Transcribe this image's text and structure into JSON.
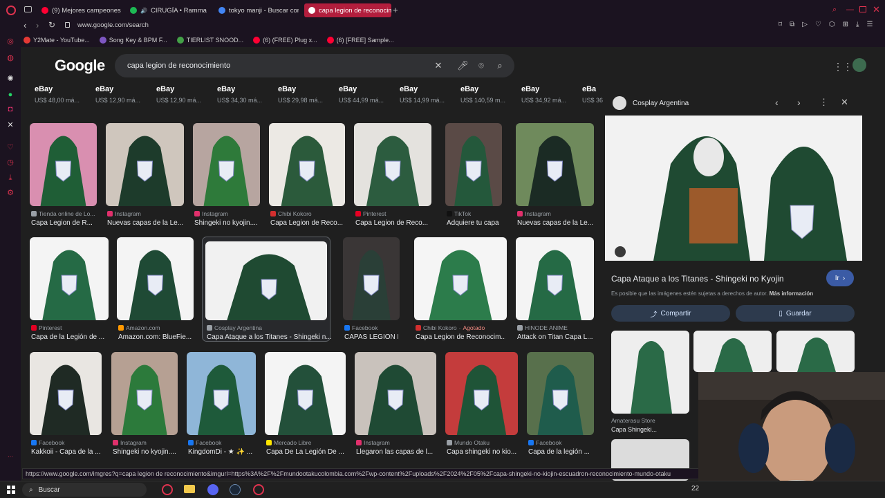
{
  "tabs": [
    {
      "label": "(9) Mejores campeones de",
      "icon": "youtube-icon",
      "color": "#ff0033"
    },
    {
      "label": "CIRUGÍA • Ramma",
      "icon": "spotify-icon",
      "color": "#1db954"
    },
    {
      "label": "tokyo manji - Buscar con",
      "icon": "google-icon",
      "color": "#4285f4"
    },
    {
      "label": "capa legion de reconocimi",
      "icon": "google-icon",
      "color": "#4285f4"
    }
  ],
  "address": "www.google.com/search",
  "bookmarks": [
    {
      "label": "Y2Mate - YouTube...",
      "color": "#e53935"
    },
    {
      "label": "Song Key & BPM F...",
      "color": "#7e57c2"
    },
    {
      "label": "TIERLIST SNOOD...",
      "color": "#43a047"
    },
    {
      "label": "(6) (FREE) Plug x...",
      "color": "#ff0033"
    },
    {
      "label": "(6) [FREE] Sample...",
      "color": "#ff0033"
    }
  ],
  "google": {
    "logo": "Google",
    "query": "capa legion de reconocimiento"
  },
  "shopping": [
    {
      "store": "eBay",
      "price": "US$ 48,00 má..."
    },
    {
      "store": "eBay",
      "price": "US$ 12,90 má..."
    },
    {
      "store": "eBay",
      "price": "US$ 12,90 má..."
    },
    {
      "store": "eBay",
      "price": "US$ 34,30 má..."
    },
    {
      "store": "eBay",
      "price": "US$ 29,98 má..."
    },
    {
      "store": "eBay",
      "price": "US$ 44,99 má..."
    },
    {
      "store": "eBay",
      "price": "US$ 14,99 má..."
    },
    {
      "store": "eBay",
      "price": "US$ 140,59 m..."
    },
    {
      "store": "eBay",
      "price": "US$ 34,92 má..."
    },
    {
      "store": "eBa",
      "price": "US$ 36"
    }
  ],
  "results": [
    {
      "source": "Tienda online de Lo...",
      "title": "Capa Legion de R...",
      "bg": "#d98fb0",
      "color": "#1f5e36"
    },
    {
      "source": "Instagram",
      "title": "Nuevas capas de la Le...",
      "bg": "#cfc6bd",
      "color": "#1d3b2b"
    },
    {
      "source": "Instagram",
      "title": "Shingeki no kyojin....",
      "bg": "#b7a5a0",
      "color": "#2e7a3a"
    },
    {
      "source": "Chibi Kokoro",
      "title": "Capa Legion de Reco...",
      "bg": "#ece9e4",
      "color": "#2b5a3b"
    },
    {
      "source": "Pinterest",
      "title": "Capa Legion de Reco...",
      "bg": "#e4e2de",
      "color": "#2c5c3f"
    },
    {
      "source": "TikTok",
      "title": "Adquiere tu capa l...",
      "bg": "#5a4a46",
      "color": "#24583b"
    },
    {
      "source": "Instagram",
      "title": "Nuevas capas de la Le...",
      "bg": "#6f8a5c",
      "color": "#1b2b24"
    },
    {
      "source": "Pinterest",
      "title": "Capa de la Legión de ...",
      "bg": "#f4f4f4",
      "color": "#256a45"
    },
    {
      "source": "Amazon.com",
      "title": "Amazon.com: BlueFie...",
      "bg": "#f4f4f4",
      "color": "#1f4a35"
    },
    {
      "source": "Cosplay Argentina",
      "title": "Capa Ataque a los Titanes - Shingeki n...",
      "bg": "#f1f1f1",
      "color": "#1f4a32"
    },
    {
      "source": "Facebook",
      "title": "CAPAS LEGION D...",
      "bg": "#3a3636",
      "color": "#2a3f37"
    },
    {
      "source": "Chibi Kokoro",
      "sourceExtra": "Agotado",
      "title": "Capa Legion de Reconocim...",
      "bg": "#f5f5f5",
      "color": "#2c7c4b"
    },
    {
      "source": "HINODE ANIME",
      "title": "Attack on Titan Capa L...",
      "bg": "#f4f4f4",
      "color": "#256a45"
    },
    {
      "source": "Facebook",
      "title": "Kakkoii - Capa de la ...",
      "bg": "#e9e6e2",
      "color": "#1f2a24"
    },
    {
      "source": "Instagram",
      "title": "Shingeki no kyojin....",
      "bg": "#b6a093",
      "color": "#2c7a3b"
    },
    {
      "source": "Facebook",
      "title": "KingdomDi - ★ ✨ ...",
      "bg": "#8fb6d8",
      "color": "#1e5a3a"
    },
    {
      "source": "Mercado Libre",
      "title": "Capa De La Legión De ...",
      "bg": "#f4f4f4",
      "color": "#23503a"
    },
    {
      "source": "Instagram",
      "title": "Llegaron las capas de l...",
      "bg": "#c9c2bc",
      "color": "#1f4a34"
    },
    {
      "source": "Mundo Otaku",
      "title": "Capa shingeki no kio...",
      "bg": "#c43c3c",
      "color": "#1f5437"
    },
    {
      "source": "Facebook",
      "title": "Capa de la legión ...",
      "bg": "#58704c",
      "color": "#1f5c4c"
    }
  ],
  "panel": {
    "source": "Cosplay Argentina",
    "title": "Capa Ataque a los Titanes - Shingeki no Kyojin",
    "go": "Ir",
    "copyright": "Es posible que las imágenes estén sujetas a derechos de autor.",
    "more_info": "Más información",
    "share": "Compartir",
    "save": "Guardar",
    "related_source": "Amaterasu Store",
    "related_title": "Capa Shingeki..."
  },
  "status_url": "https://www.google.com/imgres?q=capa legion de reconocimiento&imgurl=https%3A%2F%2Fmundootakucolombia.com%2Fwp-content%2Fuploads%2F2024%2F05%2Fcapa-shingeki-no-kiojin-escuadron-reconocimiento-mundo-otaku",
  "taskbar": {
    "search": "Buscar",
    "time": "22"
  }
}
